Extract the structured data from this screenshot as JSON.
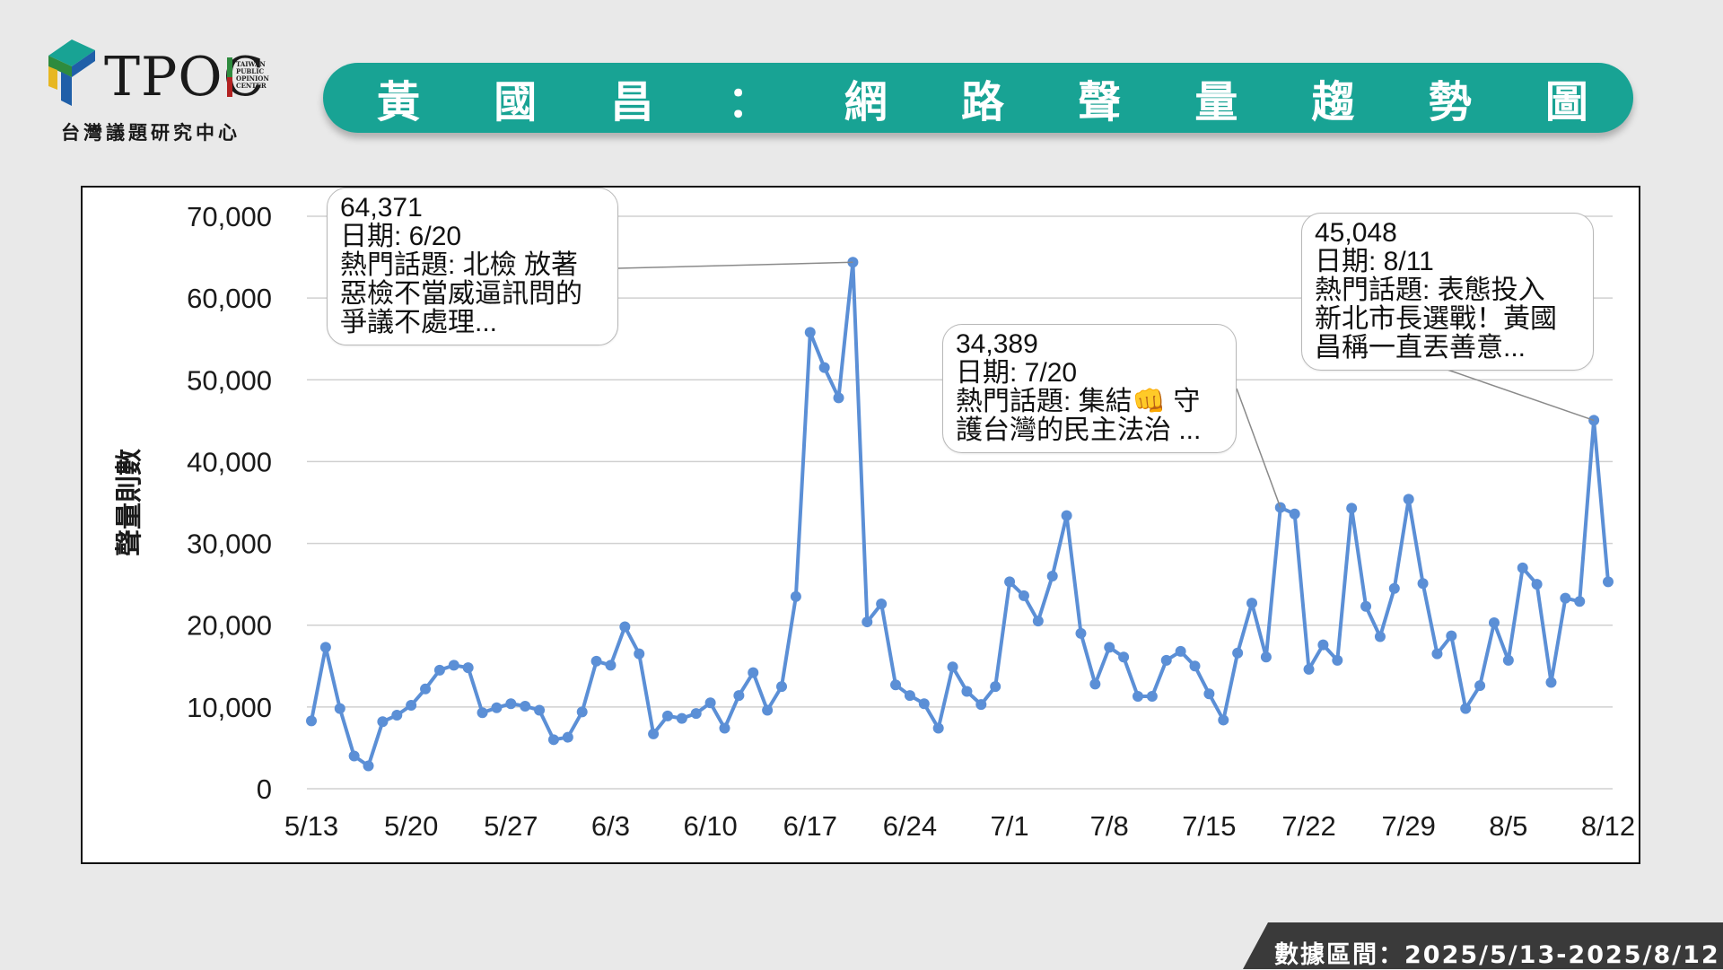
{
  "logo": {
    "wordmark": "TPOC",
    "small_lines": [
      "TAIWAN",
      "PUBLIC",
      "OPINION",
      "CENTER"
    ],
    "chinese_name": "台灣議題研究中心",
    "colors": {
      "teal": "#18a394",
      "green": "#2e8b3e",
      "yellow": "#e7b722",
      "blue": "#1f5fa8",
      "red": "#b22222"
    }
  },
  "header": {
    "title_chars": [
      "黃",
      "國",
      "昌",
      "：",
      "網",
      "路",
      "聲",
      "量",
      "趨",
      "勢",
      "圖"
    ],
    "banner_color": "#18a394"
  },
  "chart_data": {
    "type": "line",
    "ylabel": "聲量則數",
    "ylim": [
      0,
      70000
    ],
    "yticks": [
      0,
      10000,
      20000,
      30000,
      40000,
      50000,
      60000,
      70000
    ],
    "ytick_labels": [
      "0",
      "10,000",
      "20,000",
      "30,000",
      "40,000",
      "50,000",
      "60,000",
      "70,000"
    ],
    "start_date": "5/13",
    "xtick_labels": [
      "5/13",
      "5/20",
      "5/27",
      "6/3",
      "6/10",
      "6/17",
      "6/24",
      "7/1",
      "7/8",
      "7/15",
      "7/22",
      "7/29",
      "8/5",
      "8/12"
    ],
    "line_color": "#5b8fd6",
    "grid": true,
    "values": [
      8300,
      17300,
      9800,
      4000,
      2800,
      8200,
      9000,
      10200,
      12200,
      14500,
      15100,
      14800,
      9300,
      9900,
      10400,
      10100,
      9600,
      6000,
      6300,
      9400,
      15600,
      15100,
      19800,
      16500,
      6700,
      8900,
      8600,
      9200,
      10500,
      7400,
      11400,
      14200,
      9600,
      12500,
      23500,
      55800,
      51500,
      47800,
      64371,
      20400,
      22600,
      12700,
      11400,
      10400,
      7400,
      14900,
      11900,
      10300,
      12500,
      25300,
      23600,
      20500,
      26000,
      33400,
      19000,
      12800,
      17300,
      16100,
      11300,
      11300,
      15700,
      16800,
      15000,
      11600,
      8400,
      16600,
      22700,
      16100,
      34389,
      33600,
      14600,
      17600,
      15700,
      34300,
      22300,
      18600,
      24500,
      35400,
      25100,
      16500,
      18700,
      9800,
      12600,
      20300,
      15700,
      27000,
      25000,
      13000,
      23300,
      22900,
      45048,
      25300
    ],
    "annotations": [
      {
        "index": 38,
        "lines": [
          "64,371",
          "日期: 6/20",
          "熱門話題: 北檢 放著",
          "惡檢不當威逼訊問的",
          "爭議不處理..."
        ]
      },
      {
        "index": 68,
        "lines": [
          "34,389",
          "日期: 7/20",
          "熱門話題:  集結👊 守",
          "護台灣的民主法治 ..."
        ]
      },
      {
        "index": 90,
        "lines": [
          "45,048",
          "日期: 8/11",
          "熱門話題: 表態投入",
          "新北市長選戰！黃國",
          "昌稱一直丟善意..."
        ]
      }
    ]
  },
  "footer": {
    "date_range": "數據區間：2025/5/13-2025/8/12"
  }
}
